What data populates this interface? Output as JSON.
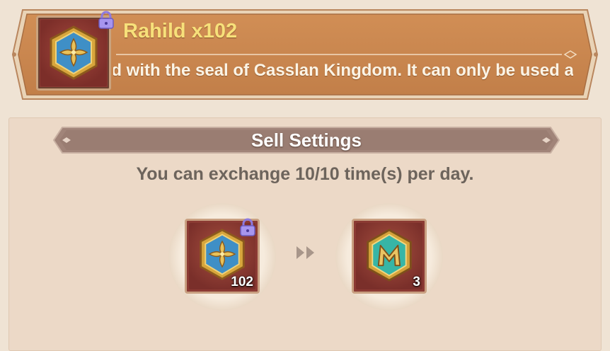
{
  "item": {
    "title": "Rahild x102",
    "description": "ed with the seal of Casslan Kingdom. It can only be used a",
    "icon": "rahild-hexagon-medal-icon",
    "locked": true
  },
  "sell_settings": {
    "title": "Sell Settings",
    "exchange_info": "You can exchange 10/10 time(s) per day.",
    "from": {
      "icon": "rahild-hexagon-medal-icon",
      "count": "102",
      "locked": true
    },
    "to": {
      "icon": "m-emblem-token-icon",
      "count": "3"
    }
  },
  "colors": {
    "banner": "#c8874f",
    "title": "#f7e07a",
    "slot": "#8b3a33",
    "lock": "#9c88e6"
  }
}
